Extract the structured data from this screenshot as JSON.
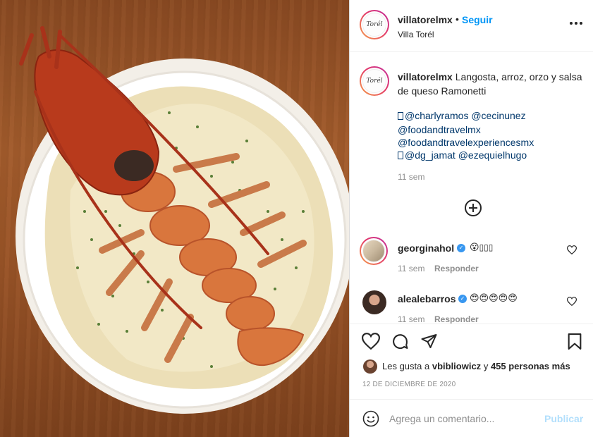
{
  "post": {
    "username": "villatorelmx",
    "follow_label": "Seguir",
    "location": "Villa Torél",
    "avatar_text": "Torél"
  },
  "caption": {
    "username": "villatorelmx",
    "text": "Langosta, arroz, orzo y salsa de queso Ramonetti",
    "mentions_line1": "@charlyramos @cecinunez",
    "mentions_line2": "@foodandtravelmx",
    "mentions_line3": "@foodandtravelexperiencesmx",
    "mentions_line4": "@dg_jamat @ezequielhugo",
    "time": "11 sem"
  },
  "comments": [
    {
      "username": "georginahol",
      "text": "😮",
      "boxes": "▯▯▯",
      "time": "11 sem",
      "reply": "Responder"
    },
    {
      "username": "alealebarros",
      "text": "😍😍😍😍😍",
      "time": "11 sem",
      "reply": "Responder"
    }
  ],
  "likes": {
    "prefix": "Les gusta a",
    "user": "vbibliowicz",
    "joiner": "y",
    "rest": "455 personas más"
  },
  "date": "12 DE DICIEMBRE DE 2020",
  "composer": {
    "placeholder": "Agrega un comentario...",
    "publish": "Publicar"
  },
  "colors": {
    "accent": "#0095f6",
    "publish_disabled": "#b2dffc",
    "muted": "#8e8e8e",
    "mention": "#00376b"
  }
}
